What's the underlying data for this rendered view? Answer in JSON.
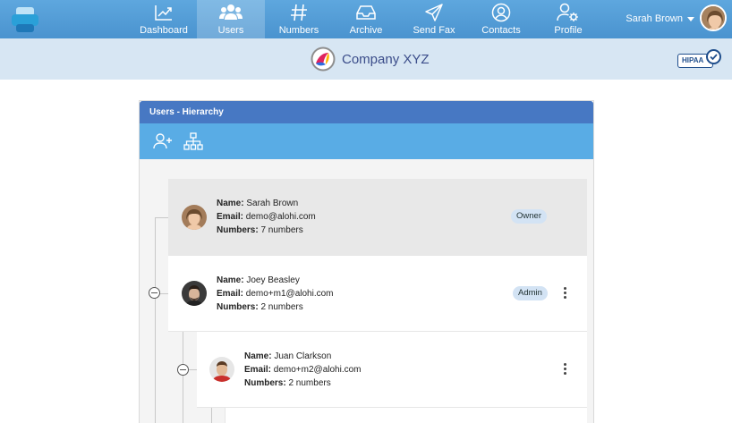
{
  "nav": {
    "items": [
      {
        "label": "Dashboard",
        "icon": "chart-line-icon"
      },
      {
        "label": "Users",
        "icon": "users-icon"
      },
      {
        "label": "Numbers",
        "icon": "hash-icon"
      },
      {
        "label": "Archive",
        "icon": "inbox-icon"
      },
      {
        "label": "Send Fax",
        "icon": "paper-plane-icon"
      },
      {
        "label": "Contacts",
        "icon": "user-circle-icon"
      },
      {
        "label": "Profile",
        "icon": "user-gear-icon"
      }
    ],
    "active": "Users",
    "user_name": "Sarah Brown"
  },
  "company": {
    "name": "Company XYZ",
    "badge": "HIPAA"
  },
  "panel": {
    "title": "Users - Hierarchy"
  },
  "users": [
    {
      "name_label": "Name:",
      "name": "Sarah Brown",
      "email_label": "Email:",
      "email": "demo@alohi.com",
      "numbers_label": "Numbers:",
      "numbers": "7 numbers",
      "role": "Owner"
    },
    {
      "name_label": "Name:",
      "name": "Joey Beasley",
      "email_label": "Email:",
      "email": "demo+m1@alohi.com",
      "numbers_label": "Numbers:",
      "numbers": "2 numbers",
      "role": "Admin"
    },
    {
      "name_label": "Name:",
      "name": "Juan Clarkson",
      "email_label": "Email:",
      "email": "demo+m2@alohi.com",
      "numbers_label": "Numbers:",
      "numbers": "2 numbers",
      "role": ""
    }
  ],
  "colors": {
    "nav_bg": "#4a93cf",
    "company_bar": "#d7e6f3",
    "panel_header": "#4778c3",
    "panel_toolbar": "#59ace5",
    "role_badge": "#d3e3f4"
  }
}
